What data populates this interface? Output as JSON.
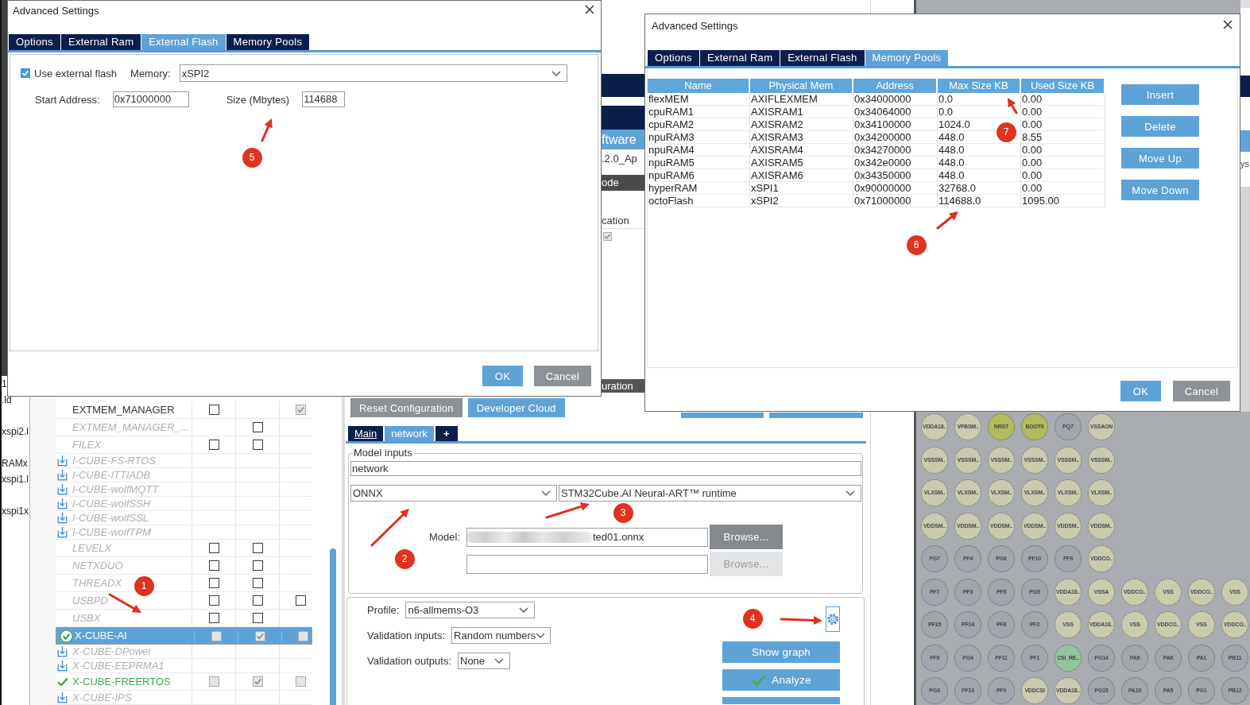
{
  "external_flash_dialog": {
    "title": "Advanced Settings",
    "tabs": [
      {
        "label": "Options",
        "selected": false
      },
      {
        "label": "External Ram",
        "selected": false
      },
      {
        "label": "External Flash",
        "selected": true
      },
      {
        "label": "Memory Pools",
        "selected": false
      }
    ],
    "use_external_flash": {
      "label": "Use external flash",
      "checked": true
    },
    "memory": {
      "label": "Memory:",
      "value": "xSPI2"
    },
    "start_address": {
      "label": "Start Address:",
      "value": "0x71000000"
    },
    "size": {
      "label": "Size (Mbytes)",
      "value": "114688"
    },
    "buttons": [
      {
        "label": "OK",
        "kind": "primary"
      },
      {
        "label": "Cancel",
        "kind": "secondary"
      }
    ]
  },
  "memory_pools_dialog": {
    "title": "Advanced Settings",
    "tabs": [
      {
        "label": "Options",
        "selected": false
      },
      {
        "label": "External Ram",
        "selected": false
      },
      {
        "label": "External Flash",
        "selected": false
      },
      {
        "label": "Memory Pools",
        "selected": true
      }
    ],
    "table": {
      "columns": [
        "Name",
        "Physical Mem",
        "Address",
        "Max Size KB",
        "Used Size KB"
      ],
      "rows": [
        [
          "flexMEM",
          "AXIFLEXMEM",
          "0x34000000",
          "0.0",
          "0.00"
        ],
        [
          "cpuRAM1",
          "AXISRAM1",
          "0x34064000",
          "0.0",
          "0.00"
        ],
        [
          "cpuRAM2",
          "AXISRAM2",
          "0x34100000",
          "1024.0",
          "0.00"
        ],
        [
          "npuRAM3",
          "AXISRAM3",
          "0x34200000",
          "448.0",
          "8.55"
        ],
        [
          "npuRAM4",
          "AXISRAM4",
          "0x34270000",
          "448.0",
          "0.00"
        ],
        [
          "npuRAM5",
          "AXISRAM5",
          "0x342e0000",
          "448.0",
          "0.00"
        ],
        [
          "npuRAM6",
          "AXISRAM6",
          "0x34350000",
          "448.0",
          "0.00"
        ],
        [
          "hyperRAM",
          "xSPI1",
          "0x90000000",
          "32768.0",
          "0.00"
        ],
        [
          "octoFlash",
          "xSPI2",
          "0x71000000",
          "114688.0",
          "1095.00"
        ]
      ]
    },
    "side_buttons": [
      "Insert",
      "Delete",
      "Move Up",
      "Move Down"
    ],
    "buttons": [
      {
        "label": "OK",
        "kind": "primary"
      },
      {
        "label": "Cancel",
        "kind": "secondary"
      }
    ]
  },
  "file_names": [
    "1",
    ".ld",
    "xspi2.l",
    "RAMx",
    "xspi1.l",
    "xspi1x"
  ],
  "components": [
    {
      "name": "EXTMEM_MANAGER",
      "kind": "standard",
      "selected": false,
      "checks": [
        {
          "kind": "checkbox",
          "checked": false,
          "disabled": false
        },
        {
          "kind": "blank"
        },
        {
          "kind": "checkbox",
          "checked": true,
          "disabled": true
        }
      ]
    },
    {
      "name": "EXTMEM_MANAGER_...",
      "kind": "unavailable",
      "selected": false,
      "checks": [
        {
          "kind": "blank"
        },
        {
          "kind": "checkbox",
          "checked": false,
          "disabled": false
        },
        {
          "kind": "blank"
        }
      ]
    },
    {
      "name": "FILEX",
      "kind": "unavailable",
      "selected": false,
      "checks": [
        {
          "kind": "checkbox",
          "checked": false,
          "disabled": false
        },
        {
          "kind": "checkbox",
          "checked": false,
          "disabled": false
        },
        {
          "kind": "blank"
        }
      ]
    },
    {
      "name": "I-CUBE-FS-RTOS",
      "kind": "downloadable",
      "selected": false,
      "checks": [
        {
          "kind": "blank"
        },
        {
          "kind": "blank"
        },
        {
          "kind": "blank"
        }
      ]
    },
    {
      "name": "I-CUBE-ITTIADB",
      "kind": "downloadable",
      "selected": false,
      "checks": [
        {
          "kind": "blank"
        },
        {
          "kind": "blank"
        },
        {
          "kind": "blank"
        }
      ]
    },
    {
      "name": "I-CUBE-wolfMQTT",
      "kind": "downloadable",
      "selected": false,
      "checks": [
        {
          "kind": "blank"
        },
        {
          "kind": "blank"
        },
        {
          "kind": "blank"
        }
      ]
    },
    {
      "name": "I-CUBE-wolfSSH",
      "kind": "downloadable",
      "selected": false,
      "checks": [
        {
          "kind": "blank"
        },
        {
          "kind": "blank"
        },
        {
          "kind": "blank"
        }
      ]
    },
    {
      "name": "I-CUBE-wolfSSL",
      "kind": "downloadable",
      "selected": false,
      "checks": [
        {
          "kind": "blank"
        },
        {
          "kind": "blank"
        },
        {
          "kind": "blank"
        }
      ]
    },
    {
      "name": "I-CUBE-wolfTPM",
      "kind": "downloadable",
      "selected": false,
      "checks": [
        {
          "kind": "blank"
        },
        {
          "kind": "blank"
        },
        {
          "kind": "blank"
        }
      ]
    },
    {
      "name": "LEVELX",
      "kind": "unavailable",
      "selected": false,
      "checks": [
        {
          "kind": "checkbox",
          "checked": false,
          "disabled": false
        },
        {
          "kind": "checkbox",
          "checked": false,
          "disabled": false
        },
        {
          "kind": "blank"
        }
      ]
    },
    {
      "name": "NETXDUO",
      "kind": "unavailable",
      "selected": false,
      "checks": [
        {
          "kind": "checkbox",
          "checked": false,
          "disabled": false
        },
        {
          "kind": "checkbox",
          "checked": false,
          "disabled": false
        },
        {
          "kind": "blank"
        }
      ]
    },
    {
      "name": "THREADX",
      "kind": "unavailable",
      "selected": false,
      "checks": [
        {
          "kind": "checkbox",
          "checked": false,
          "disabled": false
        },
        {
          "kind": "checkbox",
          "checked": false,
          "disabled": false
        },
        {
          "kind": "blank"
        }
      ]
    },
    {
      "name": "USBPD",
      "kind": "unavailable",
      "selected": false,
      "checks": [
        {
          "kind": "checkbox",
          "checked": false,
          "disabled": false
        },
        {
          "kind": "checkbox",
          "checked": false,
          "disabled": false
        },
        {
          "kind": "checkbox",
          "checked": false,
          "disabled": false
        }
      ]
    },
    {
      "name": "USBX",
      "kind": "unavailable",
      "selected": false,
      "checks": [
        {
          "kind": "checkbox",
          "checked": false,
          "disabled": false
        },
        {
          "kind": "checkbox",
          "checked": false,
          "disabled": false
        },
        {
          "kind": "blank"
        }
      ]
    },
    {
      "name": "X-CUBE-AI",
      "kind": "active",
      "selected": true,
      "checks": [
        {
          "kind": "checkbox",
          "checked": false,
          "disabled": true
        },
        {
          "kind": "checkbox",
          "checked": true,
          "disabled": true
        },
        {
          "kind": "checkbox",
          "checked": false,
          "disabled": true
        }
      ]
    },
    {
      "name": "X-CUBE-DPower",
      "kind": "downloadable",
      "selected": false,
      "checks": [
        {
          "kind": "blank"
        },
        {
          "kind": "blank"
        },
        {
          "kind": "blank"
        }
      ]
    },
    {
      "name": "X-CUBE-EEPRMA1",
      "kind": "downloadable",
      "selected": false,
      "checks": [
        {
          "kind": "blank"
        },
        {
          "kind": "blank"
        },
        {
          "kind": "blank"
        }
      ]
    },
    {
      "name": "X-CUBE-FREERTOS",
      "kind": "installed",
      "selected": false,
      "checks": [
        {
          "kind": "checkbox",
          "checked": false,
          "disabled": true
        },
        {
          "kind": "checkbox",
          "checked": true,
          "disabled": true
        },
        {
          "kind": "checkbox",
          "checked": false,
          "disabled": true
        }
      ]
    },
    {
      "name": "X-CUBE-IPS",
      "kind": "downloadable",
      "selected": false,
      "checks": [
        {
          "kind": "blank"
        },
        {
          "kind": "blank"
        },
        {
          "kind": "blank"
        }
      ]
    }
  ],
  "hidden_panel_fragments": [
    {
      "kind": "section-title",
      "text": "ftware"
    },
    {
      "kind": "value",
      "text": ".2.0_Ap"
    },
    {
      "kind": "column-header",
      "text": "ode"
    },
    {
      "kind": "label",
      "text": "cation"
    },
    {
      "kind": "checkbox",
      "checked": true
    },
    {
      "kind": "button",
      "text": "uration"
    }
  ],
  "right_edge_text": "ys",
  "toolbar_buttons": [
    {
      "label": "Reset Configuration",
      "kind": "secondary"
    },
    {
      "label": "Developer Cloud",
      "kind": "primary"
    }
  ],
  "model_tabs": [
    {
      "label": "Main",
      "kind": "tab",
      "selected": false,
      "focused": true
    },
    {
      "label": "network",
      "kind": "tab",
      "selected": true,
      "focused": false
    },
    {
      "label": "+",
      "kind": "add",
      "selected": false,
      "focused": false
    }
  ],
  "model_inputs": {
    "legend": "Model inputs",
    "name": "network",
    "framework": "ONNX",
    "runtime": "STM32Cube.AI Neural-ART™ runtime",
    "rows": [
      {
        "label": "Model:",
        "value": "ted01.onnx",
        "blurred": true,
        "button": {
          "label": "Browse...",
          "disabled": false
        }
      },
      {
        "blurred": false,
        "button": {
          "label": "Browse...",
          "disabled": true
        }
      }
    ]
  },
  "analysis": {
    "fields": [
      {
        "label": "Profile:",
        "value": "n6-allmems-O3"
      },
      {
        "label": "Validation inputs:",
        "value": "Random numbers"
      },
      {
        "label": "Validation outputs:",
        "value": "None"
      }
    ],
    "buttons": [
      {
        "label": "Show graph",
        "kind": "plain"
      },
      {
        "label": "Analyze",
        "kind": "confirm"
      }
    ]
  },
  "pinout": {
    "rows": [
      [
        {
          "label": "VDDA18..",
          "color": "#c9caae"
        },
        {
          "label": "VFBSM..",
          "color": "#c9caae"
        },
        {
          "label": "NRST",
          "color": "#b3bb5c"
        },
        {
          "label": "BOOT0",
          "color": "#b3bb5c"
        },
        {
          "label": "PQ7",
          "color": "#a2a6ad"
        },
        {
          "label": "VSSAON",
          "color": "#c9caae"
        }
      ],
      [
        {
          "label": "VSSSM..",
          "color": "#c9caae"
        },
        {
          "label": "VSSSM..",
          "color": "#c9caae"
        },
        {
          "label": "VSSSM..",
          "color": "#c9caae"
        },
        {
          "label": "VSSSM..",
          "color": "#c9caae"
        },
        {
          "label": "VSSSM..",
          "color": "#c9caae"
        },
        {
          "label": "VSSSM..",
          "color": "#c9caae"
        }
      ],
      [
        {
          "label": "VLXSM..",
          "color": "#c9caae"
        },
        {
          "label": "VLXSM..",
          "color": "#c9caae"
        },
        {
          "label": "VLXSM..",
          "color": "#c9caae"
        },
        {
          "label": "VLXSM..",
          "color": "#c9caae"
        },
        {
          "label": "VLXSM..",
          "color": "#c9caae"
        },
        {
          "label": "VLXSM..",
          "color": "#c9caae"
        }
      ],
      [
        {
          "label": "VDDSM..",
          "color": "#c9caae"
        },
        {
          "label": "VDDSM..",
          "color": "#c9caae"
        },
        {
          "label": "VDDSM..",
          "color": "#c9caae"
        },
        {
          "label": "VDDSM..",
          "color": "#c9caae"
        },
        {
          "label": "VDDSM..",
          "color": "#c9caae"
        },
        {
          "label": "VDDSM..",
          "color": "#c9caae"
        }
      ],
      [
        {
          "label": "PG7",
          "color": "#a2a6ad"
        },
        {
          "label": "PF4",
          "color": "#a2a6ad"
        },
        {
          "label": "PG6",
          "color": "#a2a6ad"
        },
        {
          "label": "PF10",
          "color": "#a2a6ad"
        },
        {
          "label": "PF6",
          "color": "#a2a6ad"
        },
        {
          "label": "VDDCO..",
          "color": "#c9caae"
        }
      ],
      [
        {
          "label": "PF7",
          "color": "#a2a6ad"
        },
        {
          "label": "PF3",
          "color": "#a2a6ad"
        },
        {
          "label": "PF5",
          "color": "#a2a6ad"
        },
        {
          "label": "PG5",
          "color": "#a2a6ad"
        },
        {
          "label": "VDDA18..",
          "color": "#c9caae"
        },
        {
          "label": "VSSA",
          "color": "#c9caae"
        },
        {
          "label": "VDDCO..",
          "color": "#c9caae"
        },
        {
          "label": "VSS",
          "color": "#c9caae"
        },
        {
          "label": "VDDCO..",
          "color": "#c9caae"
        },
        {
          "label": "VSS",
          "color": "#c9caae"
        }
      ],
      [
        {
          "label": "PF15",
          "color": "#a2a6ad"
        },
        {
          "label": "PF14",
          "color": "#a2a6ad"
        },
        {
          "label": "PF8",
          "color": "#a2a6ad"
        },
        {
          "label": "PF2",
          "color": "#a2a6ad"
        },
        {
          "label": "VSS",
          "color": "#c9caae"
        },
        {
          "label": "VDDA18..",
          "color": "#c9caae"
        },
        {
          "label": "VSS",
          "color": "#c9caae"
        },
        {
          "label": "VDDCO..",
          "color": "#c9caae"
        },
        {
          "label": "VSS",
          "color": "#c9caae"
        },
        {
          "label": "VDDCO..",
          "color": "#c9caae"
        }
      ],
      [
        {
          "label": "PF9",
          "color": "#a2a6ad"
        },
        {
          "label": "PG4",
          "color": "#a2a6ad"
        },
        {
          "label": "PF11",
          "color": "#a2a6ad"
        },
        {
          "label": "PF1",
          "color": "#a2a6ad"
        },
        {
          "label": "CSI_RE..",
          "color": "#95c49c"
        },
        {
          "label": "PG14",
          "color": "#a2a6ad"
        },
        {
          "label": "PA9",
          "color": "#a2a6ad"
        },
        {
          "label": "PA6",
          "color": "#a2a6ad"
        },
        {
          "label": "PA1",
          "color": "#a2a6ad"
        },
        {
          "label": "PB11",
          "color": "#a2a6ad"
        }
      ],
      [
        {
          "label": "PG3",
          "color": "#a2a6ad"
        },
        {
          "label": "PF13",
          "color": "#a2a6ad"
        },
        {
          "label": "PF0",
          "color": "#a2a6ad"
        },
        {
          "label": "VDDCSI",
          "color": "#c9caae"
        },
        {
          "label": "VDDA18..",
          "color": "#c9caae"
        },
        {
          "label": "PG15",
          "color": "#a2a6ad"
        },
        {
          "label": "PA10",
          "color": "#a2a6ad"
        },
        {
          "label": "PA5",
          "color": "#a2a6ad"
        },
        {
          "label": "PG1",
          "color": "#a2a6ad"
        },
        {
          "label": "PB12",
          "color": "#a2a6ad"
        }
      ]
    ]
  },
  "annotations": [
    {
      "label": "1"
    },
    {
      "label": "2"
    },
    {
      "label": "3"
    },
    {
      "label": "4"
    },
    {
      "label": "5"
    },
    {
      "label": "6"
    },
    {
      "label": "7"
    }
  ]
}
